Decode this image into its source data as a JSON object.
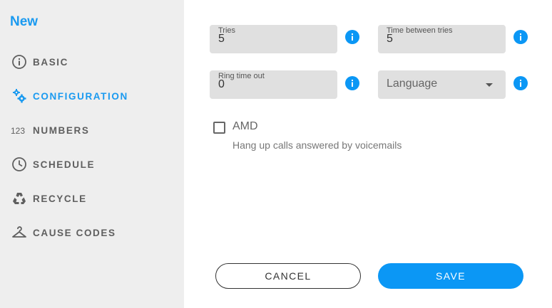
{
  "sidebar": {
    "title": "New",
    "items": [
      {
        "label": "BASIC",
        "icon": "info-circle-icon",
        "active": false
      },
      {
        "label": "CONFIGURATION",
        "icon": "gears-icon",
        "active": true
      },
      {
        "label": "NUMBERS",
        "icon": "numbers-123-icon",
        "active": false
      },
      {
        "label": "SCHEDULE",
        "icon": "clock-icon",
        "active": false
      },
      {
        "label": "RECYCLE",
        "icon": "recycle-icon",
        "active": false
      },
      {
        "label": "CAUSE CODES",
        "icon": "hanger-icon",
        "active": false
      }
    ]
  },
  "form": {
    "tries": {
      "label": "Tries",
      "value": "5"
    },
    "time_between_tries": {
      "label": "Time between tries",
      "value": "5"
    },
    "ring_time_out": {
      "label": "Ring time out",
      "value": "0"
    },
    "language": {
      "placeholder": "Language"
    },
    "amd": {
      "label": "AMD",
      "checked": false,
      "help": "Hang up calls answered by voicemails"
    }
  },
  "actions": {
    "cancel": "CANCEL",
    "save": "SAVE"
  },
  "colors": {
    "accent": "#1a9af0",
    "sidebar_bg": "#eeeeee",
    "field_bg": "#e0e0e0",
    "save_bg": "#0b97f5"
  }
}
